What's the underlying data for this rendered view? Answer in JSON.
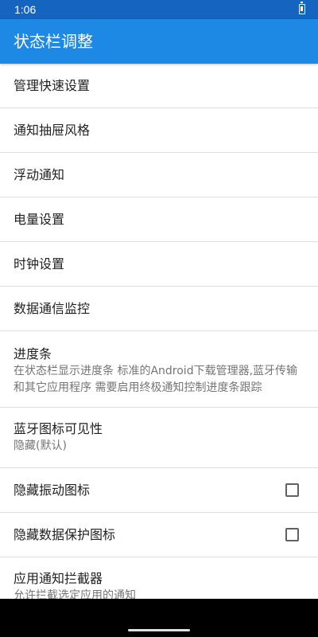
{
  "status_bar": {
    "time": "1:06",
    "battery_icon": "battery-charging-icon"
  },
  "app_bar": {
    "title": "状态栏调整"
  },
  "settings": {
    "items": [
      {
        "title": "管理快速设置"
      },
      {
        "title": "通知抽屉风格"
      },
      {
        "title": "浮动通知"
      },
      {
        "title": "电量设置"
      },
      {
        "title": "时钟设置"
      },
      {
        "title": "数据通信监控"
      },
      {
        "title": "进度条",
        "summary": "在状态栏显示进度条 标准的Android下载管理器,蓝牙传输和其它应用程序 需要启用终极通知控制进度条跟踪"
      },
      {
        "title": "蓝牙图标可见性",
        "summary": "隐藏(默认)"
      },
      {
        "title": "隐藏振动图标",
        "checked": false
      },
      {
        "title": "隐藏数据保护图标",
        "checked": false
      },
      {
        "title": "应用通知拦截器",
        "summary": "允许拦截选定应用的通知"
      }
    ]
  },
  "colors": {
    "status_bar": "#1565c0",
    "app_bar": "#1e88e5",
    "divider": "#dedede",
    "primary_text": "#212121",
    "secondary_text": "#757575"
  }
}
